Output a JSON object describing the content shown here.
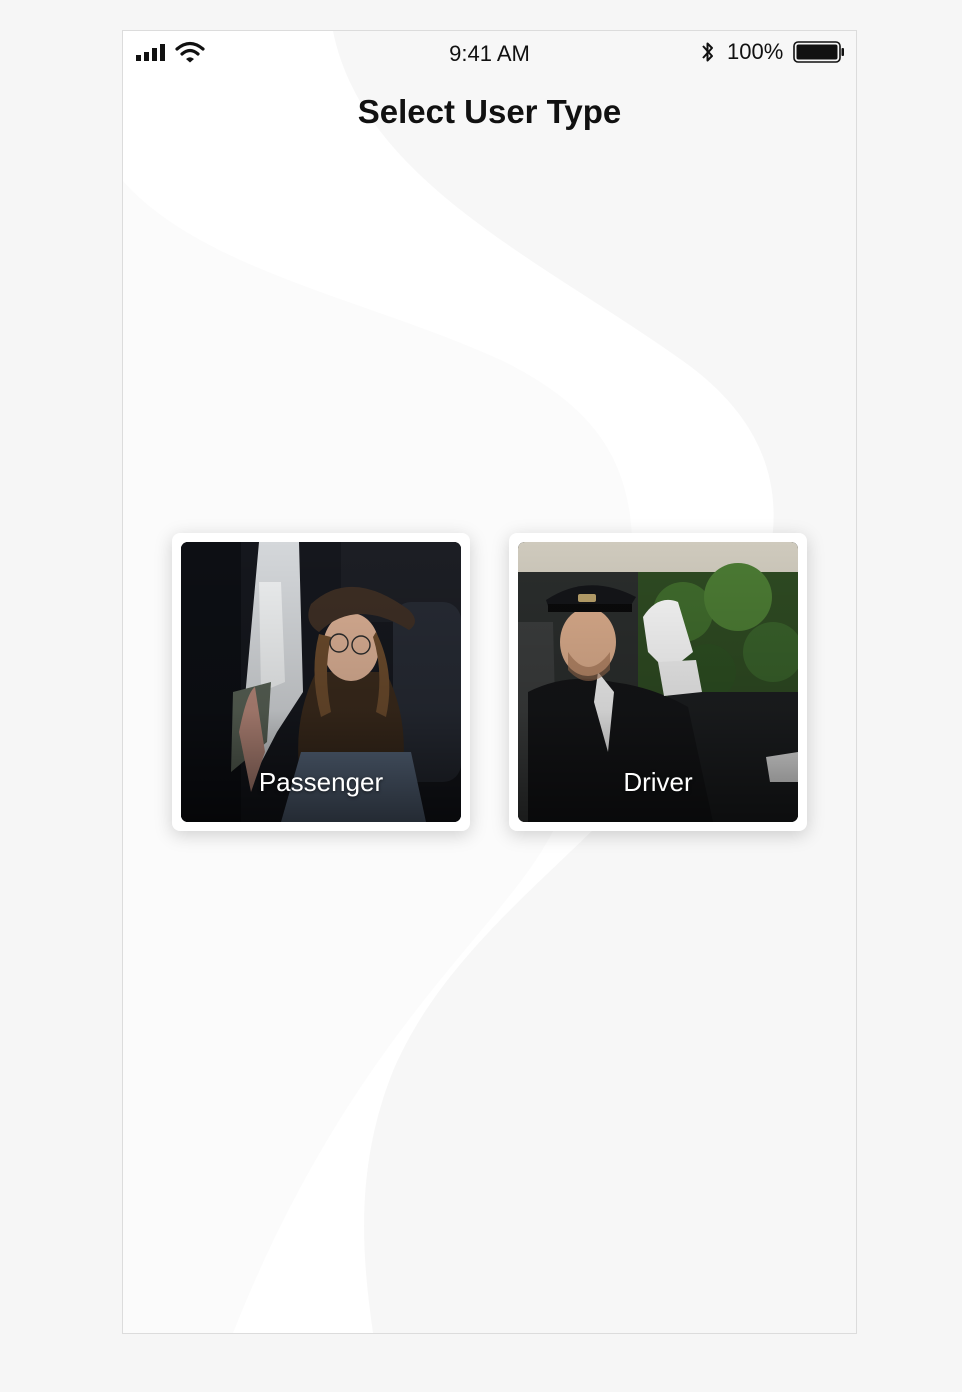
{
  "status_bar": {
    "time": "9:41 AM",
    "battery_percent": "100%",
    "battery_level": 1.0,
    "icons": [
      "signal-icon",
      "wifi-icon",
      "bluetooth-icon",
      "battery-icon"
    ]
  },
  "header": {
    "title": "Select User Type"
  },
  "user_types": [
    {
      "label": "Passenger",
      "image": "passenger-photo"
    },
    {
      "label": "Driver",
      "image": "driver-photo"
    }
  ],
  "colors": {
    "background": "#ffffff",
    "text": "#111111",
    "card_label": "#ffffff"
  }
}
